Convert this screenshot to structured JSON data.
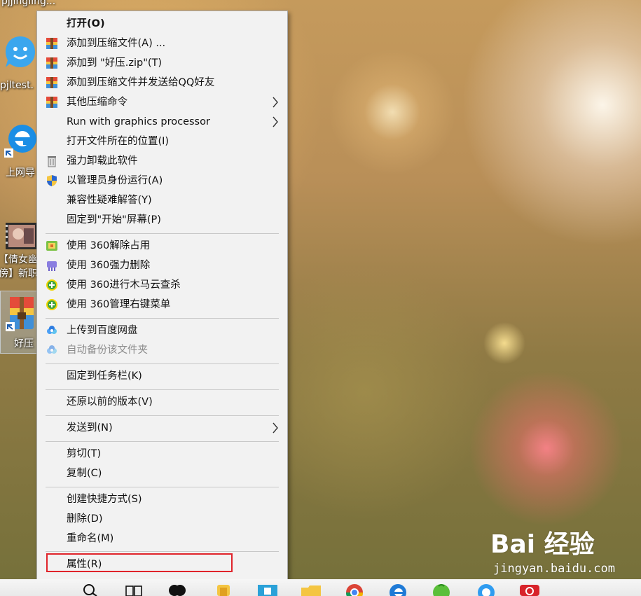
{
  "desktop": {
    "icons": [
      {
        "label": "pjjingling..."
      },
      {
        "label": "pjltest."
      },
      {
        "label": "上网导"
      },
      {
        "label_line1": "【倩女幽",
        "label_line2": "傍】新职"
      },
      {
        "label": "好压"
      }
    ]
  },
  "context_menu": {
    "items": [
      {
        "label": "打开(O)",
        "icon": "none"
      },
      {
        "label": "添加到压缩文件(A) ...",
        "icon": "archive-icon"
      },
      {
        "label": "添加到 \"好压.zip\"(T)",
        "icon": "archive-icon"
      },
      {
        "label": "添加到压缩文件并发送给QQ好友",
        "icon": "archive-icon"
      },
      {
        "label": "其他压缩命令",
        "icon": "archive-icon"
      },
      {
        "label": "Run with graphics processor",
        "icon": "none"
      },
      {
        "label": "打开文件所在的位置(I)",
        "icon": "none"
      },
      {
        "label": "强力卸载此软件",
        "icon": "trash-icon"
      },
      {
        "label": "以管理员身份运行(A)",
        "icon": "uac-shield-icon"
      },
      {
        "label": "兼容性疑难解答(Y)",
        "icon": "none"
      },
      {
        "label": "固定到\"开始\"屏幕(P)",
        "icon": "none"
      },
      {
        "label": "使用 360解除占用",
        "icon": "360-unlock-icon"
      },
      {
        "label": "使用 360强力删除",
        "icon": "360-shred-icon"
      },
      {
        "label": "使用 360进行木马云查杀",
        "icon": "360-scan-icon"
      },
      {
        "label": "使用 360管理右键菜单",
        "icon": "360-scan-icon"
      },
      {
        "label": "上传到百度网盘",
        "icon": "baidu-cloud-icon"
      },
      {
        "label": "自动备份该文件夹",
        "icon": "baidu-cloud-icon"
      },
      {
        "label": "固定到任务栏(K)",
        "icon": "none"
      },
      {
        "label": "还原以前的版本(V)",
        "icon": "none"
      },
      {
        "label": "发送到(N)",
        "icon": "none"
      },
      {
        "label": "剪切(T)",
        "icon": "none"
      },
      {
        "label": "复制(C)",
        "icon": "none"
      },
      {
        "label": "创建快捷方式(S)",
        "icon": "none"
      },
      {
        "label": "删除(D)",
        "icon": "none"
      },
      {
        "label": "重命名(M)",
        "icon": "none"
      },
      {
        "label": "属性(R)",
        "icon": "none"
      }
    ]
  },
  "watermark": {
    "logo": "Bai 经验",
    "url": "jingyan.baidu.com"
  },
  "colors": {
    "highlight_box": "#e0242b",
    "menu_background": "#f2f2f2"
  }
}
